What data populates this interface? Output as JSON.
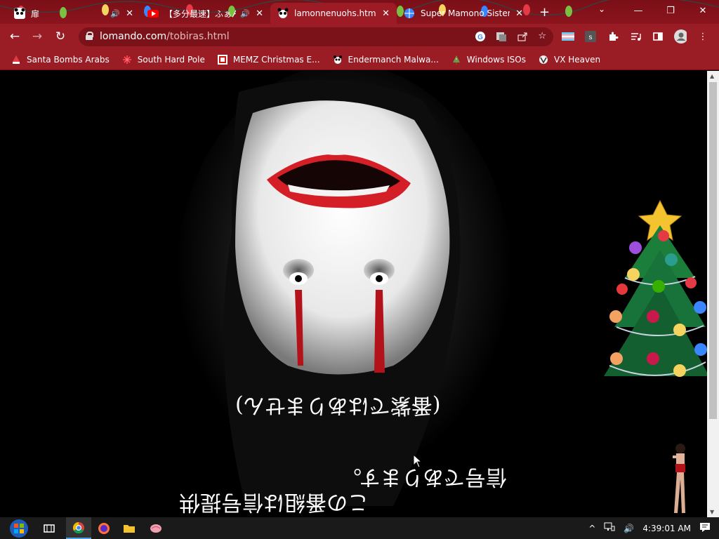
{
  "tabs": [
    {
      "title": "扉",
      "audio": true,
      "active": false
    },
    {
      "title": "【多分最速】ふぁん!",
      "audio": true,
      "active": false
    },
    {
      "title": "lamonnenuohs.html |",
      "audio": false,
      "active": true
    },
    {
      "title": "Super Mamono Sister",
      "audio": false,
      "active": false
    }
  ],
  "window_controls": {
    "minimize": "—",
    "restore": "❐",
    "close": "✕"
  },
  "toolbar": {
    "url_domain": "lomando.com",
    "url_path": "/tobiras.html",
    "back": "←",
    "forward": "→",
    "reload": "↻",
    "new_tab": "+"
  },
  "bookmarks": [
    {
      "label": "Santa Bombs Arabs",
      "icon": "santa-icon"
    },
    {
      "label": "South Hard Pole",
      "icon": "snowflake-icon"
    },
    {
      "label": "MEMZ Christmas E...",
      "icon": "memz-icon"
    },
    {
      "label": "Endermanch Malwa...",
      "icon": "panda-icon"
    },
    {
      "label": "Windows ISOs",
      "icon": "tree-icon"
    },
    {
      "label": "VX Heaven",
      "icon": "vx-icon"
    }
  ],
  "content": {
    "upside_down_line1": "(番紫ではありません)",
    "upside_down_line2": "信号であります。",
    "upside_down_line3": "この番組は信号提供"
  },
  "taskbar": {
    "time": "4:39:01 AM"
  },
  "colors": {
    "tab_strip": "#7a0f17",
    "toolbar": "#9a1d26",
    "page_bg": "#000000"
  }
}
